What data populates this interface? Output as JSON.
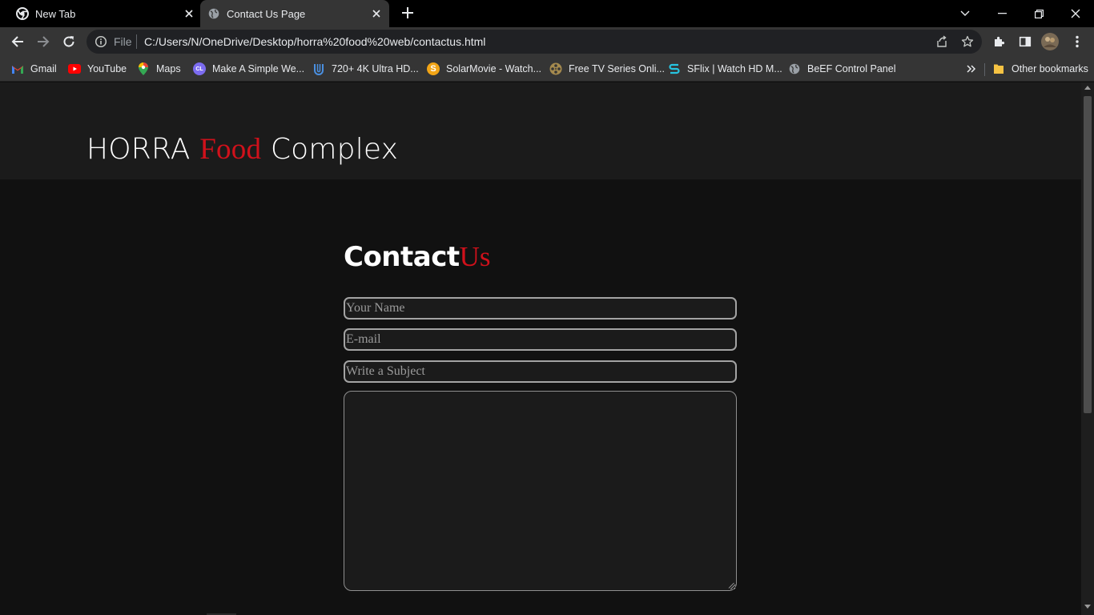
{
  "browser": {
    "tabs": [
      {
        "title": "New Tab",
        "icon": "chrome-icon"
      },
      {
        "title": "Contact Us Page",
        "icon": "globe-icon"
      }
    ],
    "omnibox": {
      "scheme_label": "File",
      "url": "C:/Users/N/OneDrive/Desktop/horra%20food%20web/contactus.html"
    },
    "bookmarks": [
      {
        "label": "Gmail",
        "icon": "gmail-icon"
      },
      {
        "label": "YouTube",
        "icon": "youtube-icon"
      },
      {
        "label": "Maps",
        "icon": "maps-icon"
      },
      {
        "label": "Make A Simple We...",
        "icon": "cl-icon",
        "icon_text": "CL"
      },
      {
        "label": "720+ 4K Ultra HD...",
        "icon": "u-logo-icon"
      },
      {
        "label": "SolarMovie - Watch...",
        "icon": "solarmovie-icon",
        "icon_text": "S"
      },
      {
        "label": "Free TV Series Onli...",
        "icon": "film-reel-icon"
      },
      {
        "label": "SFlix | Watch HD M...",
        "icon": "sflix-icon"
      },
      {
        "label": "BeEF Control Panel",
        "icon": "globe-icon"
      }
    ],
    "other_bookmarks_label": "Other bookmarks"
  },
  "page": {
    "brand": {
      "part1": "HORRA",
      "part2": "Food",
      "part3": "Complex"
    },
    "heading": {
      "part1": "Contact",
      "part2": "Us"
    },
    "form": {
      "name_placeholder": "Your Name",
      "email_placeholder": "E-mail",
      "subject_placeholder": "Write a Subject"
    }
  },
  "colors": {
    "accent": "#d0111b",
    "page_background": "#111111",
    "header_background": "#1b1b1b"
  }
}
